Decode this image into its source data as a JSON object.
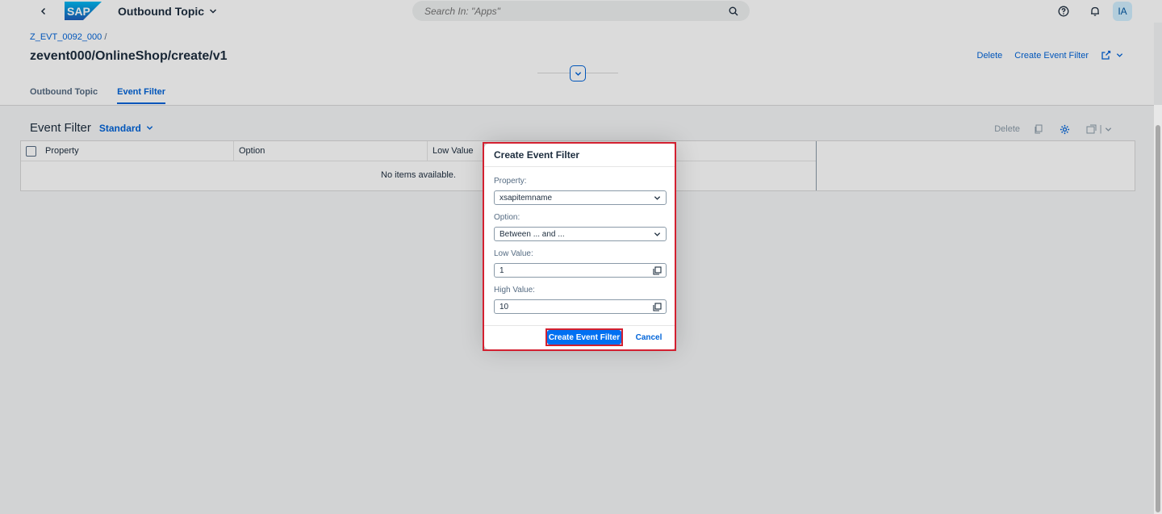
{
  "shell": {
    "app_title": "Outbound Topic",
    "search_placeholder": "Search In: \"Apps\"",
    "avatar_initials": "IA",
    "logo_text": "SAP"
  },
  "header": {
    "breadcrumb": "Z_EVT_0092_000",
    "breadcrumb_sep": "/",
    "title": "zevent000/OnlineShop/create/v1",
    "actions": {
      "delete": "Delete",
      "create": "Create Event Filter"
    },
    "tabs": [
      {
        "label": "Outbound Topic",
        "active": false
      },
      {
        "label": "Event Filter",
        "active": true
      }
    ]
  },
  "table": {
    "title": "Event Filter",
    "variant": "Standard",
    "toolbar_delete": "Delete",
    "columns": [
      "Property",
      "Option",
      "Low Value"
    ],
    "empty_text": "No items available."
  },
  "dialog": {
    "title": "Create Event Filter",
    "property_label": "Property:",
    "property_value": "xsapitemname",
    "option_label": "Option:",
    "option_value": "Between ... and ...",
    "low_label": "Low Value:",
    "low_value": "1",
    "high_label": "High Value:",
    "high_value": "10",
    "create_button": "Create Event Filter",
    "cancel_button": "Cancel"
  },
  "colors": {
    "accent": "#0064d9",
    "emphasized": "#0070f2",
    "highlight": "#d32030"
  }
}
